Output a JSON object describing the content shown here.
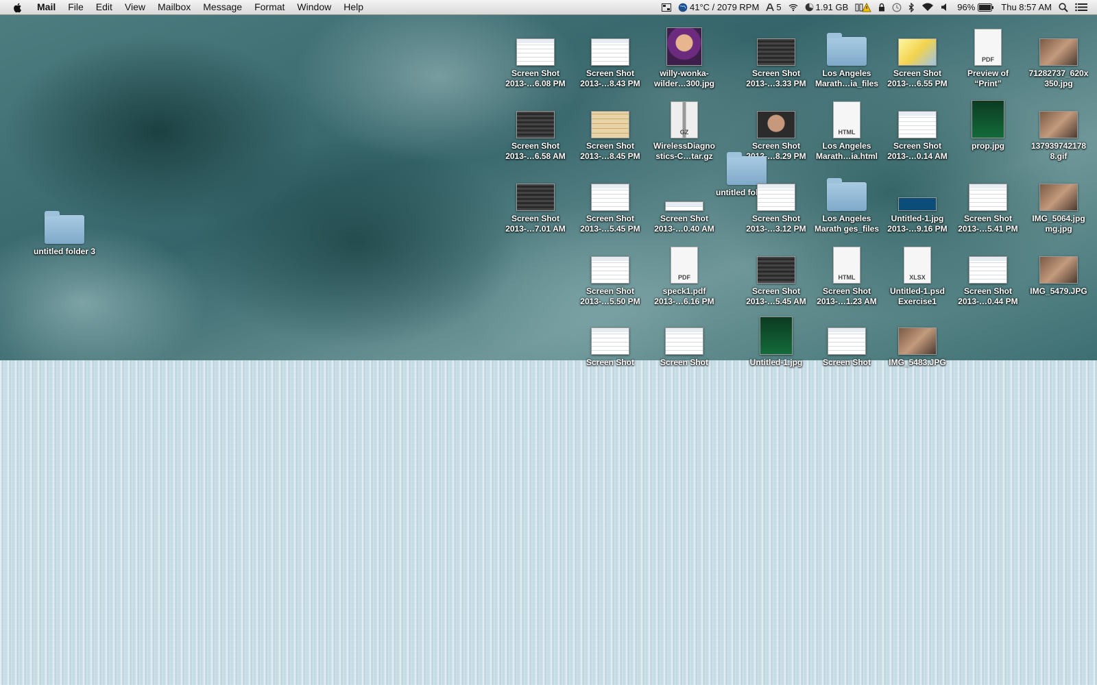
{
  "menubar": {
    "app": "Mail",
    "menus": [
      "File",
      "Edit",
      "View",
      "Mailbox",
      "Message",
      "Format",
      "Window",
      "Help"
    ],
    "status": {
      "temp": "41°C / 2079 RPM",
      "fonts_count": "5",
      "memory": "1.91 GB",
      "battery": "96%",
      "clock": "Thu 8:57 AM"
    }
  },
  "desktop": {
    "icons": [
      {
        "line1": "Screen Shot",
        "line2": "2013-…6.08 PM",
        "kind": "screenshot"
      },
      {
        "line1": "Screen Shot",
        "line2": "2013-…8.43 PM",
        "kind": "screenshot"
      },
      {
        "line1": "willy-wonka-",
        "line2": "wilder…300.jpg",
        "kind": "image"
      },
      {
        "line1": "Screen Shot",
        "line2": "2013-…3.33 PM",
        "kind": "screenshot"
      },
      {
        "line1": "Los Angeles",
        "line2": "Marath…ia_files",
        "kind": "folder"
      },
      {
        "line1": "Screen Shot",
        "line2": "2013-…6.55 PM",
        "kind": "screenshot"
      },
      {
        "line1": "Preview of",
        "line2": "“Print”",
        "kind": "pdf"
      },
      {
        "line1": "71282737_620x",
        "line2": "350.jpg",
        "kind": "image"
      },
      {
        "line1": "Screen Shot",
        "line2": "2013-…6.58 AM",
        "kind": "screenshot"
      },
      {
        "line1": "Screen Shot",
        "line2": "2013-…8.45 PM",
        "kind": "screenshot"
      },
      {
        "line1": "WirelessDiagno",
        "line2": "stics-C…tar.gz",
        "kind": "archive"
      },
      {
        "line1": "Screen Shot",
        "line2": "2013-…8.29 PM",
        "kind": "screenshot"
      },
      {
        "line1": "Los Angeles",
        "line2": "Marath…ia.html",
        "kind": "html"
      },
      {
        "line1": "Screen Shot",
        "line2": "2013-…0.14 AM",
        "kind": "screenshot"
      },
      {
        "line1": "prop.jpg",
        "line2": "",
        "kind": "image"
      },
      {
        "line1": "137939742178",
        "line2": "8.gif",
        "kind": "image"
      },
      {
        "line1": "Screen Shot",
        "line2": "2013-…7.01 AM",
        "kind": "screenshot"
      },
      {
        "line1": "Screen Shot",
        "line2": "2013-…5.45 PM",
        "kind": "screenshot"
      },
      {
        "line1": "Screen Shot",
        "line2": "2013-…0.40 AM",
        "kind": "screenshot"
      },
      {
        "line1": "untitled folder 2",
        "line2": "",
        "kind": "folder"
      },
      {
        "line1": "Screen Shot",
        "line2": "2013-…3.12 PM",
        "kind": "screenshot"
      },
      {
        "line1": "Los Angeles",
        "line2": "Marath ges_files",
        "kind": "folder"
      },
      {
        "line1": "Untitled-1.jpg",
        "line2": "2013-…9.16 PM",
        "kind": "image"
      },
      {
        "line1": "Screen Shot",
        "line2": "2013-…5.41 PM",
        "kind": "screenshot"
      },
      {
        "line1": "IMG_5064.jpg",
        "line2": "mg.jpg",
        "kind": "image"
      },
      {
        "line1": "untitled folder 3",
        "line2": "",
        "kind": "folder"
      },
      {
        "line1": "Screen Shot",
        "line2": "2013-…5.50 PM",
        "kind": "screenshot"
      },
      {
        "line1": "speck1.pdf",
        "line2": "2013-…6.16 PM",
        "kind": "pdf"
      },
      {
        "line1": "Screen Shot",
        "line2": "2013-…5.45 AM",
        "kind": "screenshot"
      },
      {
        "line1": "Screen Shot",
        "line2": "2013-…1.23 AM",
        "kind": "html"
      },
      {
        "line1": "Untitled-1.psd",
        "line2": "Exercise1",
        "kind": "xlsx"
      },
      {
        "line1": "Screen Shot",
        "line2": "2013-…0.44 PM",
        "kind": "screenshot"
      },
      {
        "line1": "IMG_5479.JPG",
        "line2": "",
        "kind": "image"
      },
      {
        "line1": "Screen Shot",
        "line2": "",
        "kind": "screenshot"
      },
      {
        "line1": "Screen Shot",
        "line2": "",
        "kind": "screenshot"
      },
      {
        "line1": "Untitled-1.jpg",
        "line2": "",
        "kind": "image"
      },
      {
        "line1": "Screen Shot",
        "line2": "",
        "kind": "screenshot"
      },
      {
        "line1": "IMG_5483.JPG",
        "line2": "",
        "kind": "image"
      }
    ]
  }
}
